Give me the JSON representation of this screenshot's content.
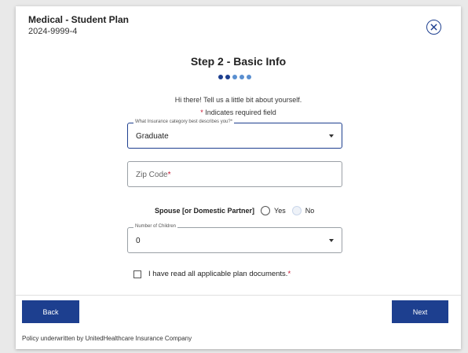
{
  "header": {
    "plan_title": "Medical - Student Plan",
    "plan_id": "2024-9999-4"
  },
  "step": {
    "title": "Step 2 - Basic Info",
    "total_steps": 5,
    "current_step": 2,
    "dot_color_filled": "#1d3f8f",
    "dot_color_empty": "#5a8fd0"
  },
  "intro_text": "Hi there! Tell us a little bit about yourself.",
  "required_note": {
    "star": "*",
    "text": " Indicates required field"
  },
  "insurance_category": {
    "label": "What Insurance category best describes you?*",
    "value": "Graduate"
  },
  "zip_code": {
    "placeholder": "Zip Code",
    "required_star": "*",
    "value": ""
  },
  "spouse": {
    "label": "Spouse [or Domestic Partner]",
    "yes_label": "Yes",
    "no_label": "No"
  },
  "children": {
    "label": "Number of Children",
    "value": "0"
  },
  "agreement": {
    "label": "I have read all applicable plan documents.",
    "required_star": "*"
  },
  "buttons": {
    "back": "Back",
    "next": "Next"
  },
  "footer": "Policy underwritten by UnitedHealthcare Insurance Company",
  "colors": {
    "primary": "#1d3f8f",
    "required": "#c8102e"
  }
}
